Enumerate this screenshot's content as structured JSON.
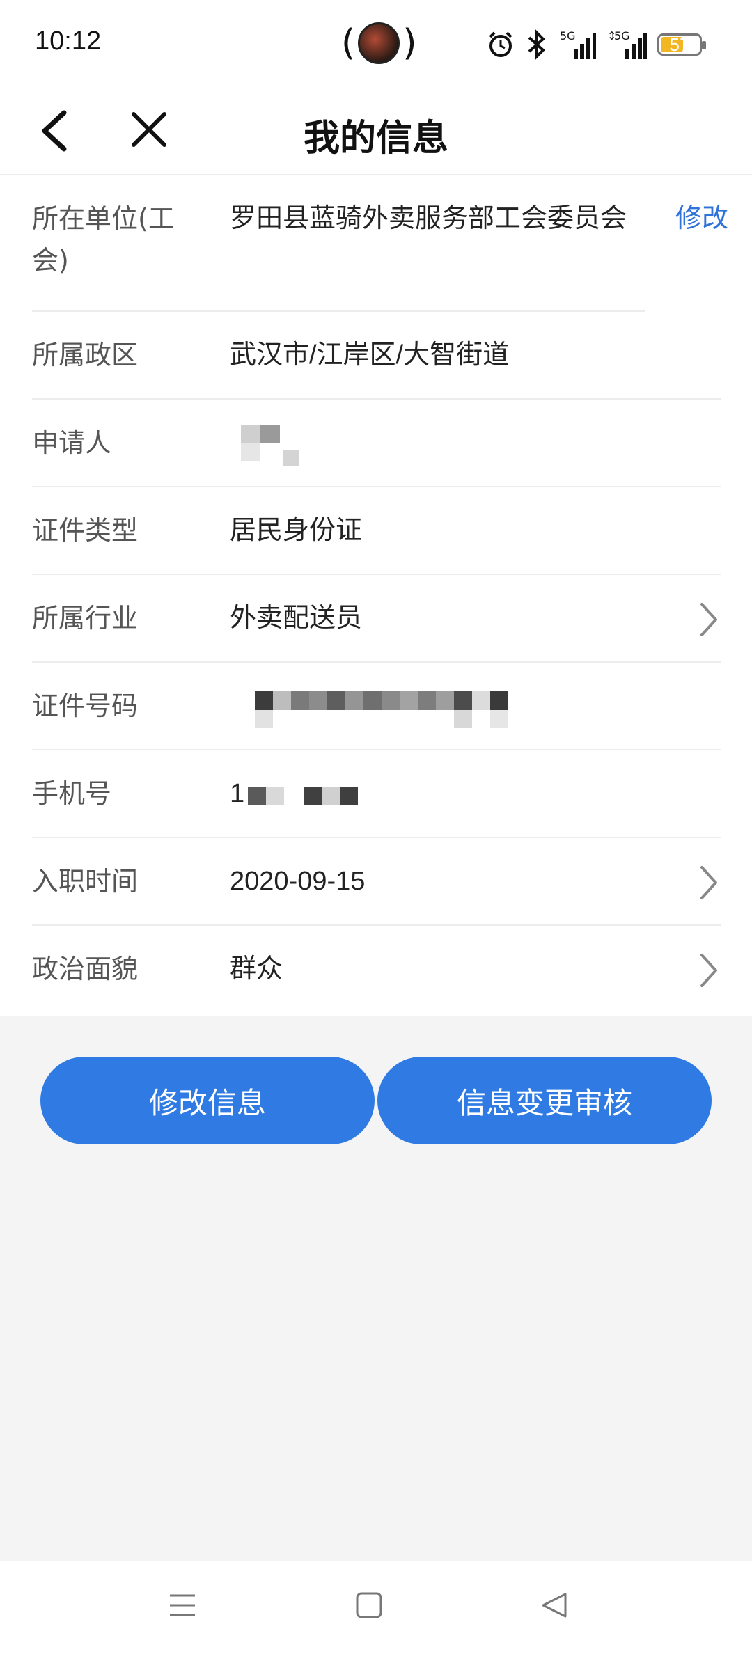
{
  "status_bar": {
    "time": "10:12",
    "battery": "57",
    "signal_labels": [
      "5G",
      "5G"
    ]
  },
  "nav": {
    "title": "我的信息",
    "back_icon": "chevron-left-icon",
    "close_icon": "close-icon"
  },
  "info": {
    "edit_link": "修改",
    "rows": [
      {
        "label": "所在单位(工会)",
        "value": "罗田县蓝骑外卖服务部工会委员会"
      },
      {
        "label": "所属政区",
        "value": "武汉市/江岸区/大智街道"
      },
      {
        "label": "申请人",
        "value": ""
      },
      {
        "label": "证件类型",
        "value": "居民身份证"
      },
      {
        "label": "所属行业",
        "value": "外卖配送员"
      },
      {
        "label": "证件号码",
        "value": ""
      },
      {
        "label": "手机号",
        "value": "1"
      },
      {
        "label": "入职时间",
        "value": "2020-09-15"
      },
      {
        "label": "政治面貌",
        "value": "群众"
      }
    ]
  },
  "actions": {
    "modify_label": "修改信息",
    "review_label": "信息变更审核"
  },
  "colors": {
    "accent": "#2f7be3",
    "link": "#2f73d9",
    "battery": "#f2b623"
  }
}
